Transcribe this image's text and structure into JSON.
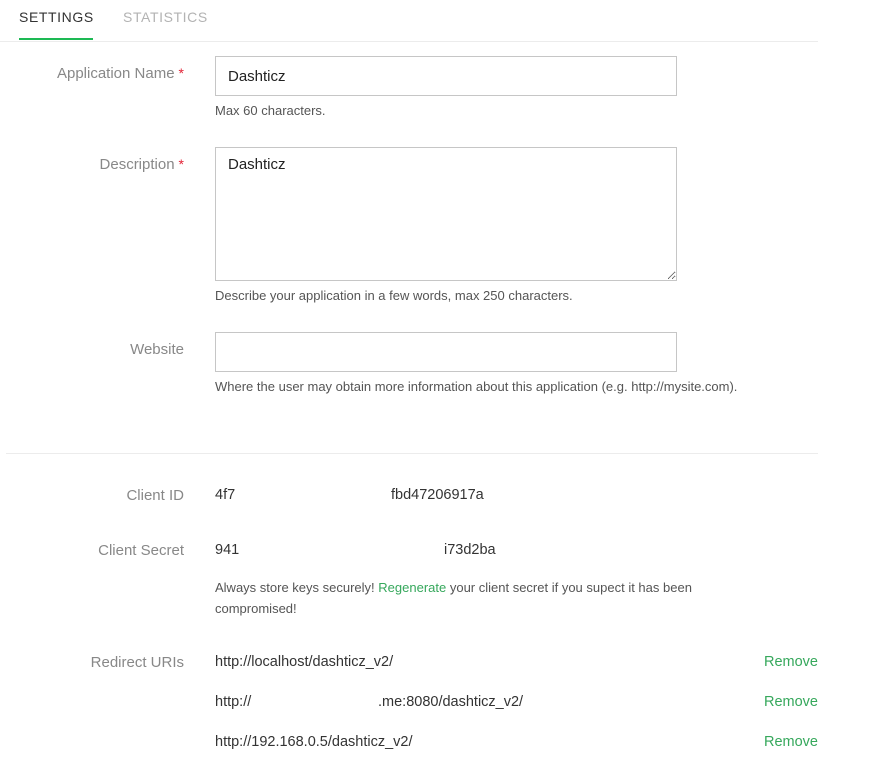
{
  "tabs": {
    "settings": "SETTINGS",
    "statistics": "STATISTICS"
  },
  "form": {
    "app_name": {
      "label": "Application Name",
      "required_mark": "*",
      "value": "Dashticz",
      "help": "Max 60 characters."
    },
    "description": {
      "label": "Description",
      "required_mark": "*",
      "value": "Dashticz",
      "help": "Describe your application in a few words, max 250 characters."
    },
    "website": {
      "label": "Website",
      "value": "",
      "help": "Where the user may obtain more information about this application (e.g. http://mysite.com)."
    }
  },
  "credentials": {
    "client_id": {
      "label": "Client ID",
      "value_start": "4f7",
      "value_end": "fbd47206917a"
    },
    "client_secret": {
      "label": "Client Secret",
      "value_start": "941",
      "value_end": "i73d2ba"
    },
    "note_before": "Always store keys securely! ",
    "regenerate_link": "Regenerate",
    "note_after": " your client secret if you supect it has been compromised!"
  },
  "redirects": {
    "label": "Redirect URIs",
    "remove_label": "Remove",
    "items": [
      {
        "start": "http://localhost/dashticz_v2/",
        "end": ""
      },
      {
        "start": "http://",
        "end": ".me:8080/dashticz_v2/"
      },
      {
        "start": "http://192.168.0.5/dashticz_v2/",
        "end": ""
      }
    ]
  },
  "colors": {
    "accent": "#1db954",
    "link": "#36a85c",
    "required": "#e22134"
  }
}
